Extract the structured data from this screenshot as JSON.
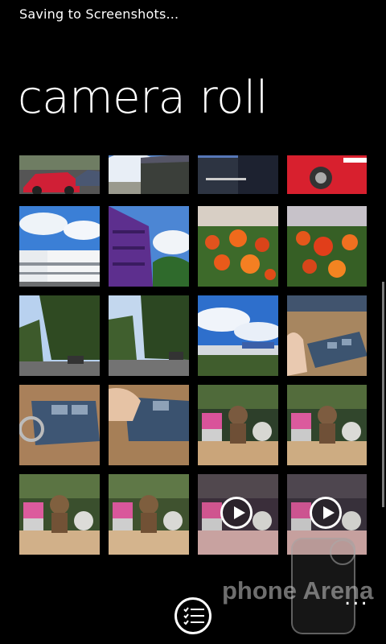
{
  "status_bar": {
    "text": "Saving to Screenshots..."
  },
  "page": {
    "title": "camera roll"
  },
  "thumbnails": [
    {
      "subject": "red car on street",
      "video": false
    },
    {
      "subject": "building and sky",
      "video": false
    },
    {
      "subject": "dark office building",
      "video": false
    },
    {
      "subject": "red car close-up",
      "video": false
    },
    {
      "subject": "white building with blue sky",
      "video": false
    },
    {
      "subject": "purple building",
      "video": false
    },
    {
      "subject": "orange flowers",
      "video": false
    },
    {
      "subject": "orange flowers",
      "video": false
    },
    {
      "subject": "tree-lined street",
      "video": false
    },
    {
      "subject": "tree-lined street",
      "video": false
    },
    {
      "subject": "clouds over building",
      "video": false
    },
    {
      "subject": "hand holding remote",
      "video": false
    },
    {
      "subject": "car key remote",
      "video": false
    },
    {
      "subject": "car key remote with finger",
      "video": false
    },
    {
      "subject": "teddy bear and toys",
      "video": false
    },
    {
      "subject": "teddy bear and toys",
      "video": false
    },
    {
      "subject": "teddy bear and toys",
      "video": false
    },
    {
      "subject": "teddy bear and toys",
      "video": false
    },
    {
      "subject": "teddy bear video",
      "video": true
    },
    {
      "subject": "teddy bear video",
      "video": true
    }
  ],
  "app_bar": {
    "primary_icon": "select-list-icon",
    "more_label": "..."
  },
  "watermark": {
    "text": "phone Arena"
  },
  "colors": {
    "background": "#000000",
    "foreground": "#ffffff"
  }
}
